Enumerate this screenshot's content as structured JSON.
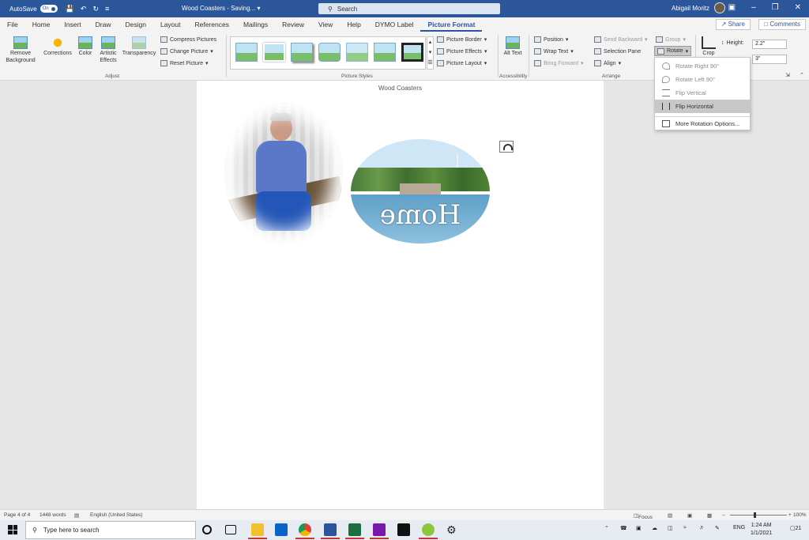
{
  "title_bar": {
    "autosave_label": "AutoSave",
    "autosave_state": "On",
    "doc_title": "Wood Coasters - Saving... ▾",
    "search_placeholder": "Search",
    "user_name": "Abigail Moritz"
  },
  "tabs": [
    "File",
    "Home",
    "Insert",
    "Draw",
    "Design",
    "Layout",
    "References",
    "Mailings",
    "Review",
    "View",
    "Help",
    "DYMO Label",
    "Picture Format"
  ],
  "share_label": "Share",
  "comments_label": "Comments",
  "ribbon": {
    "remove_bg": "Remove Background",
    "corrections": "Corrections",
    "color": "Color",
    "artistic": "Artistic Effects",
    "transparency": "Transparency",
    "compress": "Compress Pictures",
    "change_picture": "Change Picture",
    "reset_picture": "Reset Picture",
    "group_adjust": "Adjust",
    "group_styles": "Picture Styles",
    "picture_border": "Picture Border",
    "picture_effects": "Picture Effects",
    "picture_layout": "Picture Layout",
    "alt_text": "Alt Text",
    "group_accessibility": "Accessibility",
    "position": "Position",
    "wrap_text": "Wrap Text",
    "bring_forward": "Bring Forward",
    "send_backward": "Send Backward",
    "selection_pane": "Selection Pane",
    "align": "Align",
    "group_btn": "Group",
    "rotate": "Rotate",
    "group_arrange": "Arrange",
    "crop": "Crop",
    "height_label": "Height:",
    "height_value": "2.2\"",
    "width_value": "3\""
  },
  "rotate_menu": {
    "items": [
      "Rotate Right 90°",
      "Rotate Left 90°",
      "Flip Vertical",
      "Flip Horizontal",
      "More Rotation Options..."
    ],
    "highlighted_index": 3
  },
  "document": {
    "header": "Wood Coasters",
    "image_text": "Home"
  },
  "status_bar": {
    "page": "Page 4 of 4",
    "words": "1448 words",
    "language": "English (United States)",
    "focus": "Focus",
    "zoom": "100%"
  },
  "taskbar": {
    "search_placeholder": "Type here to search",
    "lang": "ENG",
    "time": "1:24 AM",
    "date": "1/1/2021",
    "notification_count": "21"
  },
  "colors": {
    "word_blue": "#2b579a",
    "menu_highlight": "#c8c8c8"
  }
}
